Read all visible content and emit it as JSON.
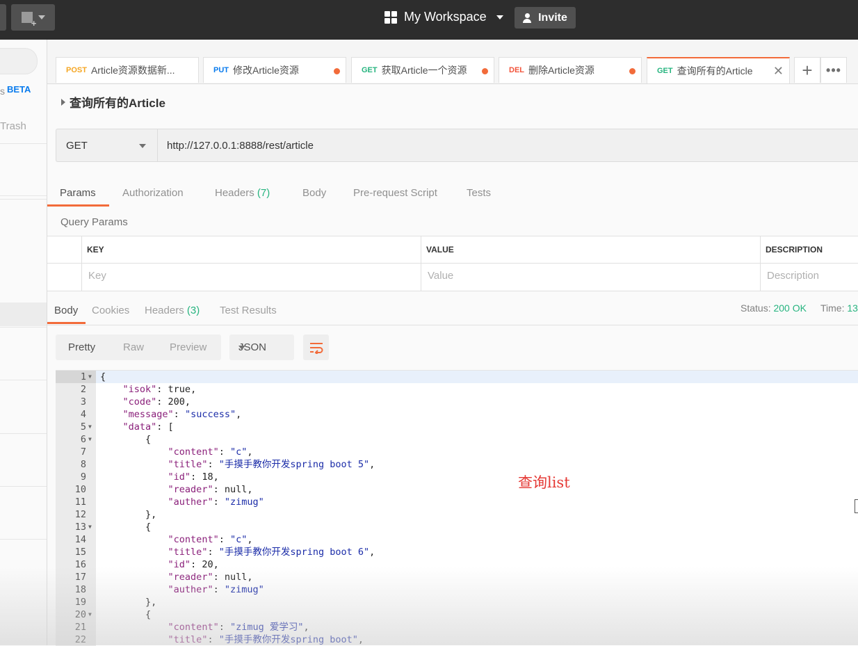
{
  "topbar": {
    "workspace_label": "My Workspace",
    "invite_label": "Invite"
  },
  "sidebar": {
    "beta_badge": "BETA",
    "trash_label": "Trash",
    "partial_s": "s"
  },
  "tabs": [
    {
      "method": "POST",
      "method_color": "#f5a623",
      "title": "Article资源数据新...",
      "unsaved": false
    },
    {
      "method": "PUT",
      "method_color": "#097bed",
      "title": "修改Article资源",
      "unsaved": true
    },
    {
      "method": "GET",
      "method_color": "#26b47f",
      "title": "获取Article一个资源",
      "unsaved": true
    },
    {
      "method": "DEL",
      "method_color": "#f2533a",
      "title": "删除Article资源",
      "unsaved": true
    },
    {
      "method": "GET",
      "method_color": "#26b47f",
      "title": "查询所有的Article",
      "active": true
    }
  ],
  "request": {
    "name": "查询所有的Article",
    "method": "GET",
    "url": "http://127.0.0.1:8888/rest/article",
    "tabs": {
      "params": "Params",
      "authorization": "Authorization",
      "headers": "Headers",
      "headers_count": "(7)",
      "body": "Body",
      "prerequest": "Pre-request Script",
      "tests": "Tests"
    },
    "query_params_title": "Query Params",
    "table": {
      "col_key": "KEY",
      "col_value": "VALUE",
      "col_description": "DESCRIPTION",
      "ph_key": "Key",
      "ph_value": "Value",
      "ph_description": "Description"
    }
  },
  "response": {
    "tabs": {
      "body": "Body",
      "cookies": "Cookies",
      "headers": "Headers",
      "headers_count": "(3)",
      "test_results": "Test Results"
    },
    "status_label": "Status:",
    "status_value": "200 OK",
    "time_label": "Time:",
    "time_value": "13",
    "view_modes": [
      "Pretty",
      "Raw",
      "Preview"
    ],
    "format": "JSON",
    "lines": [
      {
        "n": "1",
        "fold": true,
        "segs": [
          [
            "p",
            "{"
          ]
        ]
      },
      {
        "n": "2",
        "segs": [
          [
            "p",
            "    "
          ],
          [
            "k",
            "\"isok\""
          ],
          [
            "p",
            ": true,"
          ]
        ]
      },
      {
        "n": "3",
        "segs": [
          [
            "p",
            "    "
          ],
          [
            "k",
            "\"code\""
          ],
          [
            "p",
            ": 200,"
          ]
        ]
      },
      {
        "n": "4",
        "segs": [
          [
            "p",
            "    "
          ],
          [
            "k",
            "\"message\""
          ],
          [
            "p",
            ": "
          ],
          [
            "s",
            "\"success\""
          ],
          [
            "p",
            ","
          ]
        ]
      },
      {
        "n": "5",
        "fold": true,
        "segs": [
          [
            "p",
            "    "
          ],
          [
            "k",
            "\"data\""
          ],
          [
            "p",
            ": ["
          ]
        ]
      },
      {
        "n": "6",
        "fold": true,
        "segs": [
          [
            "p",
            "        {"
          ]
        ]
      },
      {
        "n": "7",
        "segs": [
          [
            "p",
            "            "
          ],
          [
            "k",
            "\"content\""
          ],
          [
            "p",
            ": "
          ],
          [
            "s",
            "\"c\""
          ],
          [
            "p",
            ","
          ]
        ]
      },
      {
        "n": "8",
        "segs": [
          [
            "p",
            "            "
          ],
          [
            "k",
            "\"title\""
          ],
          [
            "p",
            ": "
          ],
          [
            "s",
            "\"手摸手教你开发spring boot 5\""
          ],
          [
            "p",
            ","
          ]
        ]
      },
      {
        "n": "9",
        "segs": [
          [
            "p",
            "            "
          ],
          [
            "k",
            "\"id\""
          ],
          [
            "p",
            ": 18,"
          ]
        ]
      },
      {
        "n": "10",
        "segs": [
          [
            "p",
            "            "
          ],
          [
            "k",
            "\"reader\""
          ],
          [
            "p",
            ": null,"
          ]
        ]
      },
      {
        "n": "11",
        "segs": [
          [
            "p",
            "            "
          ],
          [
            "k",
            "\"auther\""
          ],
          [
            "p",
            ": "
          ],
          [
            "s",
            "\"zimug\""
          ]
        ]
      },
      {
        "n": "12",
        "segs": [
          [
            "p",
            "        },"
          ]
        ]
      },
      {
        "n": "13",
        "fold": true,
        "segs": [
          [
            "p",
            "        {"
          ]
        ]
      },
      {
        "n": "14",
        "segs": [
          [
            "p",
            "            "
          ],
          [
            "k",
            "\"content\""
          ],
          [
            "p",
            ": "
          ],
          [
            "s",
            "\"c\""
          ],
          [
            "p",
            ","
          ]
        ]
      },
      {
        "n": "15",
        "segs": [
          [
            "p",
            "            "
          ],
          [
            "k",
            "\"title\""
          ],
          [
            "p",
            ": "
          ],
          [
            "s",
            "\"手摸手教你开发spring boot 6\""
          ],
          [
            "p",
            ","
          ]
        ]
      },
      {
        "n": "16",
        "segs": [
          [
            "p",
            "            "
          ],
          [
            "k",
            "\"id\""
          ],
          [
            "p",
            ": 20,"
          ]
        ]
      },
      {
        "n": "17",
        "segs": [
          [
            "p",
            "            "
          ],
          [
            "k",
            "\"reader\""
          ],
          [
            "p",
            ": null,"
          ]
        ]
      },
      {
        "n": "18",
        "segs": [
          [
            "p",
            "            "
          ],
          [
            "k",
            "\"auther\""
          ],
          [
            "p",
            ": "
          ],
          [
            "s",
            "\"zimug\""
          ]
        ]
      },
      {
        "n": "19",
        "segs": [
          [
            "p",
            "        },"
          ]
        ]
      },
      {
        "n": "20",
        "fold": true,
        "segs": [
          [
            "p",
            "        {"
          ]
        ]
      },
      {
        "n": "21",
        "segs": [
          [
            "p",
            "            "
          ],
          [
            "k",
            "\"content\""
          ],
          [
            "p",
            ": "
          ],
          [
            "s",
            "\"zimug 爱学习\""
          ],
          [
            "p",
            ","
          ]
        ]
      },
      {
        "n": "22",
        "segs": [
          [
            "p",
            "            "
          ],
          [
            "k",
            "\"title\""
          ],
          [
            "p",
            ": "
          ],
          [
            "s",
            "\"手摸手教你开发spring boot\""
          ],
          [
            "p",
            ","
          ]
        ]
      }
    ]
  },
  "annotation": "查询list",
  "colors": {
    "accent": "#f26b3a",
    "status_ok": "#26b47f",
    "json_key": "#8a1f7a",
    "json_string": "#1b2ca8",
    "annotation": "#e53935"
  }
}
